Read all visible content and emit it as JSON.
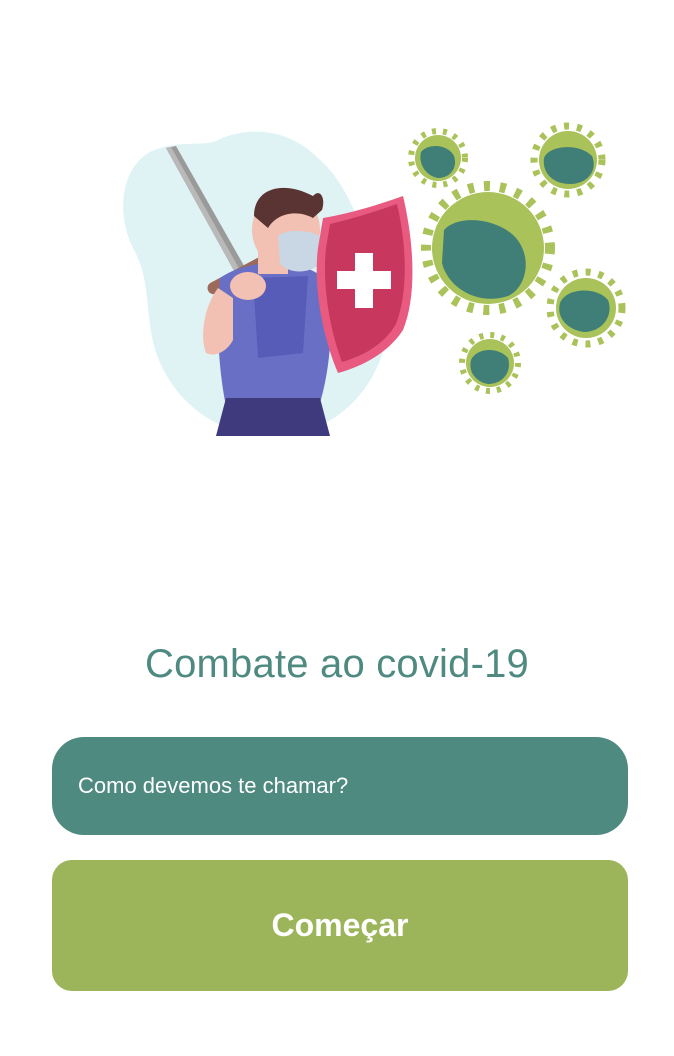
{
  "app": {
    "title": "Combate ao covid-19"
  },
  "illustration": {
    "icon": "hero-fighting-virus-illustration",
    "colors": {
      "blob": "#dff3f5",
      "shirt": "#6a6fc6",
      "pants": "#3f3a7d",
      "skin": "#f2c1b3",
      "hair": "#5a3333",
      "mask": "#c9d6e4",
      "shield": "#c8375e",
      "shield_rim": "#e85a7f",
      "sword": "#8a8a8a",
      "virus_outer": "#a9c25a",
      "virus_inner": "#3f7f78"
    }
  },
  "form": {
    "name_placeholder": "Como devemos te chamar?",
    "name_value": "",
    "start_label": "Começar"
  },
  "colors": {
    "primary": "#4e8a80",
    "accent": "#9db55a",
    "background": "#ffffff"
  }
}
